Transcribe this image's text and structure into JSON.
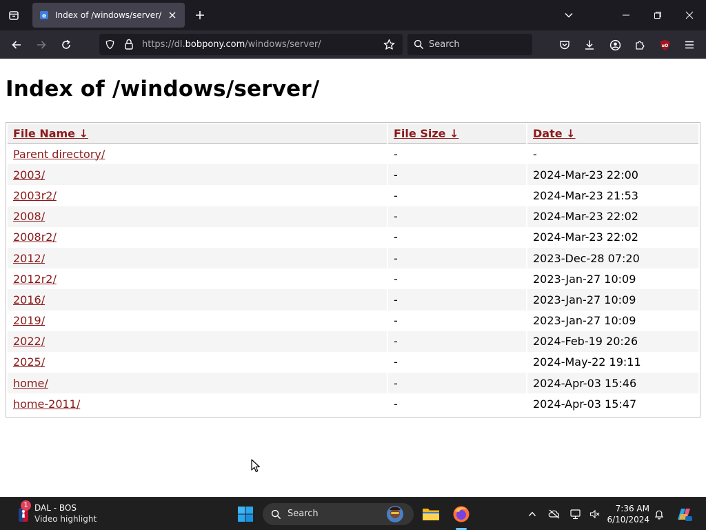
{
  "browser": {
    "tab": {
      "title": "Index of /windows/server/"
    },
    "url": {
      "prefix": "https://dl.",
      "host": "bobpony.com",
      "path": "/windows/server/"
    },
    "search_placeholder": "Search",
    "extension_badge": "uO"
  },
  "page": {
    "title": "Index of /windows/server/",
    "columns": {
      "name": "File Name  ↓",
      "size": "File Size  ↓",
      "date": "Date  ↓"
    },
    "rows": [
      {
        "name": "Parent directory/",
        "size": "-",
        "date": "-"
      },
      {
        "name": "2003/",
        "size": "-",
        "date": "2024-Mar-23 22:00"
      },
      {
        "name": "2003r2/",
        "size": "-",
        "date": "2024-Mar-23 21:53"
      },
      {
        "name": "2008/",
        "size": "-",
        "date": "2024-Mar-23 22:02"
      },
      {
        "name": "2008r2/",
        "size": "-",
        "date": "2024-Mar-23 22:02"
      },
      {
        "name": "2012/",
        "size": "-",
        "date": "2023-Dec-28 07:20"
      },
      {
        "name": "2012r2/",
        "size": "-",
        "date": "2023-Jan-27 10:09"
      },
      {
        "name": "2016/",
        "size": "-",
        "date": "2023-Jan-27 10:09"
      },
      {
        "name": "2019/",
        "size": "-",
        "date": "2023-Jan-27 10:09"
      },
      {
        "name": "2022/",
        "size": "-",
        "date": "2024-Feb-19 20:26"
      },
      {
        "name": "2025/",
        "size": "-",
        "date": "2024-May-22 19:11"
      },
      {
        "name": "home/",
        "size": "-",
        "date": "2024-Apr-03 15:46"
      },
      {
        "name": "home-2011/",
        "size": "-",
        "date": "2024-Apr-03 15:47"
      }
    ]
  },
  "taskbar": {
    "widget": {
      "title": "DAL - BOS",
      "subtitle": "Video highlight",
      "badge": "1"
    },
    "search_label": "Search",
    "clock": {
      "time": "7:36 AM",
      "date": "6/10/2024"
    }
  },
  "colors": {
    "link": "#8b1a1a",
    "chrome_dark": "#1c1b22",
    "toolbar": "#2b2a33",
    "taskbar": "#1f1f1f"
  }
}
